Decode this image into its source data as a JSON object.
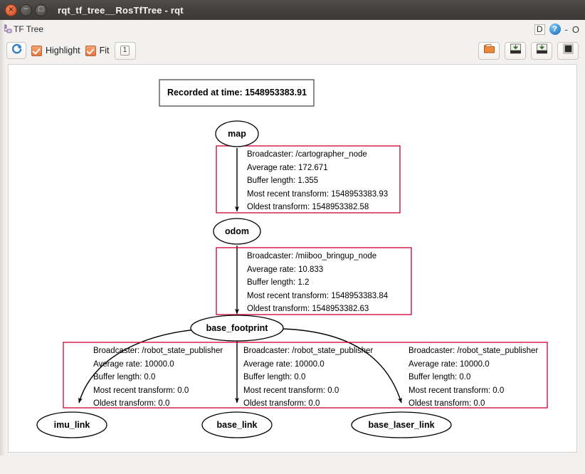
{
  "window": {
    "title": "rqt_tf_tree__RosTfTree - rqt",
    "buttons": [
      {
        "name": "close",
        "glyph": "×"
      },
      {
        "name": "minimize",
        "glyph": "−"
      },
      {
        "name": "maximize",
        "glyph": "□"
      }
    ]
  },
  "dock": {
    "icon": "tf-tree-plugin-icon",
    "title": "TF Tree",
    "float_label": "D",
    "help_label": "?",
    "minimize_label": "-",
    "close_label": "O"
  },
  "toolbar": {
    "refresh_icon": "refresh-icon",
    "highlight_label": "Highlight",
    "highlight_checked": true,
    "fit_label": "Fit",
    "fit_checked": true,
    "count_label": "1",
    "right_buttons": [
      {
        "name": "load-dot-button",
        "icon": "open-folder-icon"
      },
      {
        "name": "save-dot-button",
        "icon": "save-dot-icon"
      },
      {
        "name": "save-image-button",
        "icon": "save-image-icon"
      },
      {
        "name": "image-preview-button",
        "icon": "image-icon"
      }
    ]
  },
  "graph": {
    "recorded_label": "Recorded at time: 1548953383.91",
    "nodes": [
      {
        "id": "map",
        "label": "map"
      },
      {
        "id": "odom",
        "label": "odom"
      },
      {
        "id": "base_footprint",
        "label": "base_footprint"
      },
      {
        "id": "imu_link",
        "label": "imu_link"
      },
      {
        "id": "base_link",
        "label": "base_link"
      },
      {
        "id": "base_laser_link",
        "label": "base_laser_link"
      }
    ],
    "edges": [
      {
        "from": "map",
        "to": "odom",
        "broadcaster": "Broadcaster: /cartographer_node",
        "average_rate": "Average rate: 172.671",
        "buffer_length": "Buffer length: 1.355",
        "most_recent_transform": "Most recent transform: 1548953383.93",
        "oldest_transform": "Oldest transform: 1548953382.58"
      },
      {
        "from": "odom",
        "to": "base_footprint",
        "broadcaster": "Broadcaster: /miiboo_bringup_node",
        "average_rate": "Average rate: 10.833",
        "buffer_length": "Buffer length: 1.2",
        "most_recent_transform": "Most recent transform: 1548953383.84",
        "oldest_transform": "Oldest transform: 1548953382.63"
      },
      {
        "from": "base_footprint",
        "to": "imu_link",
        "broadcaster": "Broadcaster: /robot_state_publisher",
        "average_rate": "Average rate: 10000.0",
        "buffer_length": "Buffer length: 0.0",
        "most_recent_transform": "Most recent transform: 0.0",
        "oldest_transform": "Oldest transform: 0.0"
      },
      {
        "from": "base_footprint",
        "to": "base_link",
        "broadcaster": "Broadcaster: /robot_state_publisher",
        "average_rate": "Average rate: 10000.0",
        "buffer_length": "Buffer length: 0.0",
        "most_recent_transform": "Most recent transform: 0.0",
        "oldest_transform": "Oldest transform: 0.0"
      },
      {
        "from": "base_footprint",
        "to": "base_laser_link",
        "broadcaster": "Broadcaster: /robot_state_publisher",
        "average_rate": "Average rate: 10000.0",
        "buffer_length": "Buffer length: 0.0",
        "most_recent_transform": "Most recent transform: 0.0",
        "oldest_transform": "Oldest transform: 0.0"
      }
    ]
  },
  "colors": {
    "edge_box_border": "#cc0033",
    "titlebar": "#434140",
    "chrome": "#f2f1f0",
    "accent_orange": "#e8763a"
  }
}
